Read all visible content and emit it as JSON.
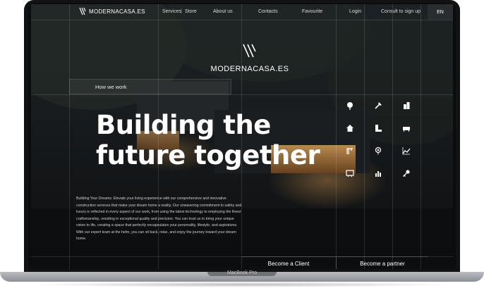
{
  "brand": "MODERNACASA.ES",
  "nav": {
    "services": "Services",
    "store": "Store",
    "about": "About us",
    "contacts": "Contacts",
    "favourite": "Favourite",
    "login": "Login",
    "consult": "Consult to sign up",
    "lang": "EN"
  },
  "section_label": "How we work",
  "headline": {
    "line1": "Building the",
    "line2": "future together"
  },
  "paragraph": "Building Your Dreams: Elevate your living experience with our comprehensive and innovative construction services that make your dream home a reality. Our unwavering commitment to safety and luxury is reflected in every aspect of our work, from using the latest technology to employing the finest craftsmanship, resulting in exceptional quality and precision. You can trust us to bring your unique vision to life, creating a space that perfectly encapsulates your personality, lifestyle, and aspirations. With our expert team at the helm, you can sit back, relax, and enjoy the journey toward your dream home.",
  "buttons": {
    "client": "Become a Client",
    "partner": "Become a partner"
  },
  "device_label": "MacBook Pro",
  "icons": [
    "tree-icon",
    "hammer-icon",
    "building-icon",
    "house-icon",
    "stairs-icon",
    "sofa-icon",
    "crane-icon",
    "location-pin-icon",
    "chart-line-icon",
    "blueprint-icon",
    "bar-chart-icon",
    "key-icon"
  ],
  "colors": {
    "screen_bg": "#15181a",
    "text": "#ffffff",
    "accent_window": "#e0a45a"
  }
}
